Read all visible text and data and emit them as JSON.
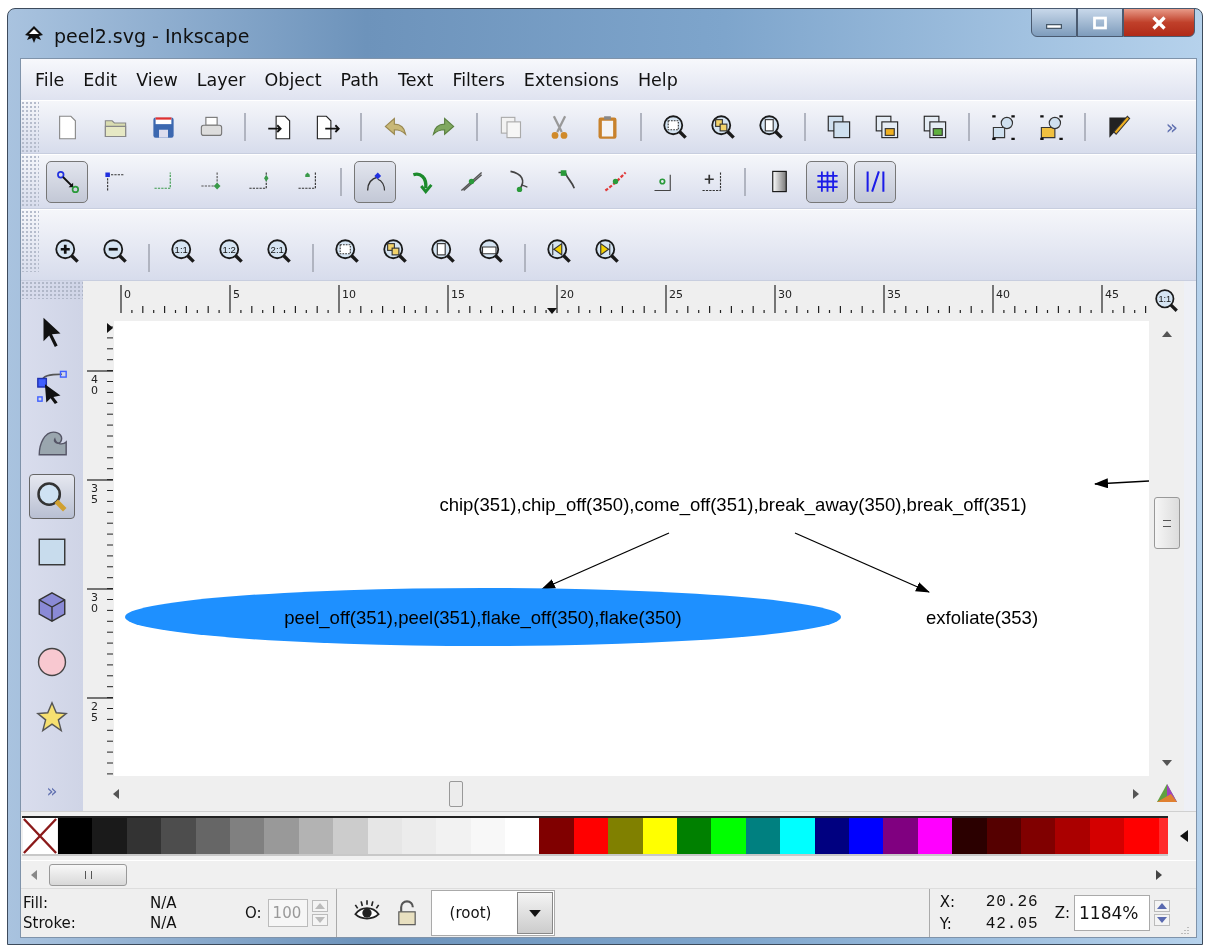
{
  "window": {
    "title": "peel2.svg - Inkscape"
  },
  "menu": [
    "File",
    "Edit",
    "View",
    "Layer",
    "Object",
    "Path",
    "Text",
    "Filters",
    "Extensions",
    "Help"
  ],
  "commands_toolbar": {
    "overflow": "»"
  },
  "snap_toolbar": [
    {
      "selected": true
    },
    {
      "selected": false
    },
    {
      "selected": false
    },
    {
      "selected": false
    },
    {
      "selected": false
    },
    {
      "selected": false
    },
    {
      "selected": true
    },
    {
      "selected": false
    },
    {
      "selected": false
    },
    {
      "selected": false
    },
    {
      "selected": false
    },
    {
      "selected": false
    },
    {
      "selected": false
    },
    {
      "selected": false
    },
    {
      "selected": false
    },
    {
      "selected": true
    },
    {
      "selected": true
    }
  ],
  "zoom_toolbar": {
    "ratio_labels": [
      "1:1",
      "1:2",
      "2:1"
    ]
  },
  "rulers": {
    "horizontal_labels": [
      "0",
      "5",
      "10",
      "15",
      "20",
      "25",
      "30",
      "35",
      "40",
      "45"
    ],
    "vertical_labels": [
      "40",
      "35",
      "30",
      "25"
    ],
    "zoom_label": "1:1"
  },
  "toolbox": {
    "tools": [
      {
        "selected": false
      },
      {
        "selected": false
      },
      {
        "selected": false
      },
      {
        "selected": true
      },
      {
        "selected": false
      },
      {
        "selected": false
      },
      {
        "selected": false
      },
      {
        "selected": false
      }
    ],
    "overflow": "»"
  },
  "canvas": {
    "nodes": [
      {
        "kind": "text",
        "label": "chip(351),chip_off(350),come_off(351),break_away(350),break_off(351)"
      },
      {
        "kind": "ellipse",
        "label": "peel_off(351),peel(351),flake_off(350),flake(350)"
      },
      {
        "kind": "text",
        "label": "exfoliate(353)"
      }
    ]
  },
  "palette": [
    {
      "kind": "none"
    },
    {
      "kind": "swatch",
      "color": "#000000"
    },
    {
      "kind": "swatch",
      "color": "#1a1a1a"
    },
    {
      "kind": "swatch",
      "color": "#333333"
    },
    {
      "kind": "swatch",
      "color": "#4d4d4d"
    },
    {
      "kind": "swatch",
      "color": "#666666"
    },
    {
      "kind": "swatch",
      "color": "#808080"
    },
    {
      "kind": "swatch",
      "color": "#999999"
    },
    {
      "kind": "swatch",
      "color": "#b3b3b3"
    },
    {
      "kind": "swatch",
      "color": "#cccccc"
    },
    {
      "kind": "swatch",
      "color": "#e6e6e6"
    },
    {
      "kind": "swatch",
      "color": "#ececec"
    },
    {
      "kind": "swatch",
      "color": "#f2f2f2"
    },
    {
      "kind": "swatch",
      "color": "#f8f8f8"
    },
    {
      "kind": "swatch",
      "color": "#ffffff"
    },
    {
      "kind": "swatch",
      "color": "#800000"
    },
    {
      "kind": "swatch",
      "color": "#ff0000"
    },
    {
      "kind": "swatch",
      "color": "#808000"
    },
    {
      "kind": "swatch",
      "color": "#ffff00"
    },
    {
      "kind": "swatch",
      "color": "#008000"
    },
    {
      "kind": "swatch",
      "color": "#00ff00"
    },
    {
      "kind": "swatch",
      "color": "#008080"
    },
    {
      "kind": "swatch",
      "color": "#00ffff"
    },
    {
      "kind": "swatch",
      "color": "#000080"
    },
    {
      "kind": "swatch",
      "color": "#0000ff"
    },
    {
      "kind": "swatch",
      "color": "#800080"
    },
    {
      "kind": "swatch",
      "color": "#ff00ff"
    },
    {
      "kind": "swatch",
      "color": "#2b0000"
    },
    {
      "kind": "swatch",
      "color": "#550000"
    },
    {
      "kind": "swatch",
      "color": "#800000"
    },
    {
      "kind": "swatch",
      "color": "#aa0000"
    },
    {
      "kind": "swatch",
      "color": "#d40000"
    },
    {
      "kind": "swatch",
      "color": "#ff0000"
    },
    {
      "kind": "swatch",
      "color": "#ff2a2a"
    }
  ],
  "status": {
    "fill_label": "Fill:",
    "fill_value": "N/A",
    "stroke_label": "Stroke:",
    "stroke_value": "N/A",
    "opacity_label": "O:",
    "opacity_value": "100",
    "opacity_disabled": true,
    "layer": "(root)",
    "x_label": "X:",
    "x_value": "20.26",
    "y_label": "Y:",
    "y_value": "42.05",
    "zoom_label": "Z:",
    "zoom_value": "1184%"
  }
}
